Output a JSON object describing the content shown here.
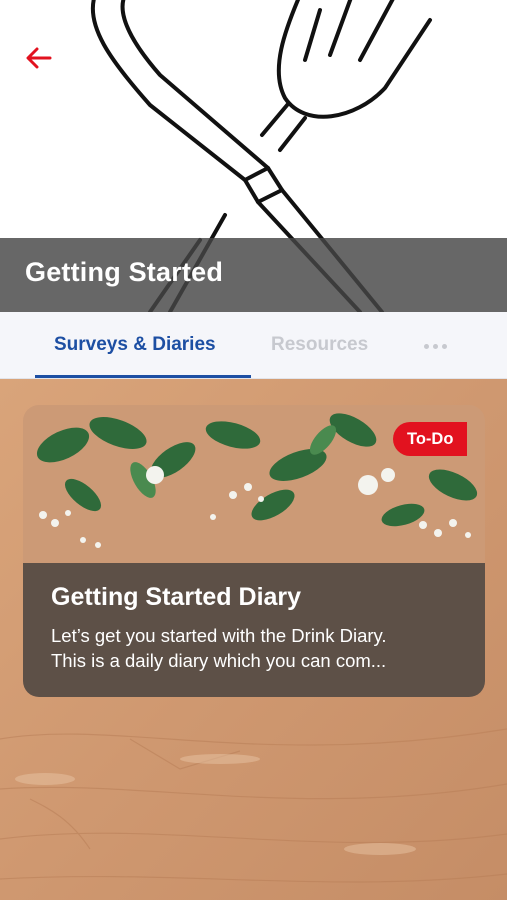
{
  "header": {
    "title": "Getting Started",
    "back_icon": "arrow-left-icon",
    "accent_color": "#e2121f"
  },
  "tabs": [
    {
      "label": "Surveys & Diaries",
      "active": true
    },
    {
      "label": "Resources",
      "active": false
    }
  ],
  "tabs_overflow_icon": "more-horizontal-icon",
  "colors": {
    "tab_active": "#1d4fa3",
    "tab_inactive": "#c7c9cf"
  },
  "cards": [
    {
      "title": "Getting Started Diary",
      "description_line1": "Let’s get you started with the Drink Diary.",
      "description_line2": "This is a daily diary which you can com...",
      "badge": "To-Do"
    }
  ]
}
